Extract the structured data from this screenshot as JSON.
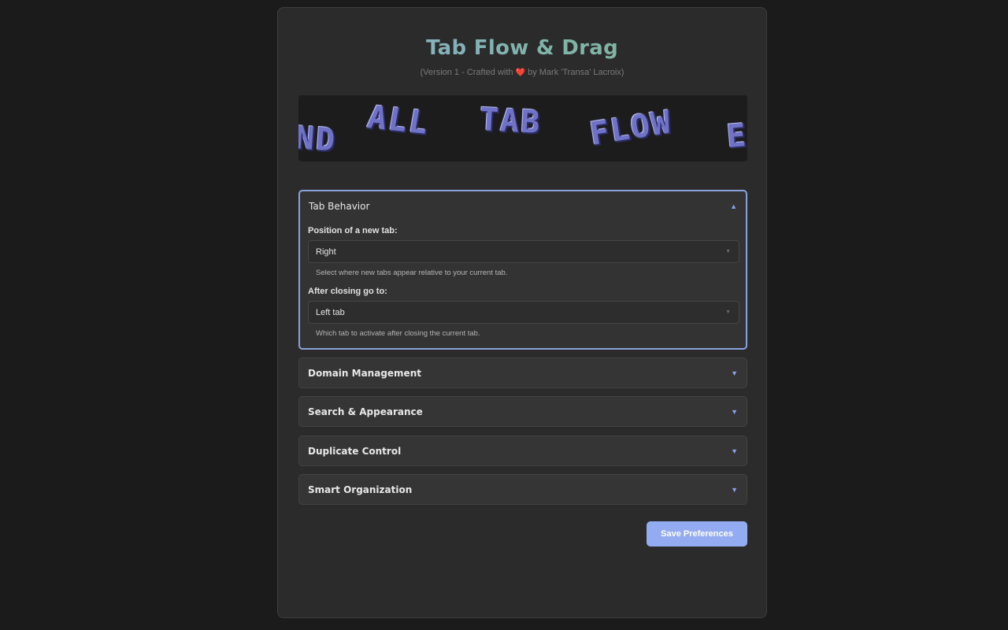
{
  "app": {
    "title": "Tab Flow & Drag",
    "subtitle_prefix": "(Version 1 - Crafted with",
    "subtitle_heart": "❤️",
    "subtitle_suffix": "by Mark 'Transa' Lacroix)"
  },
  "banner": {
    "words": [
      "ND",
      "ALL",
      "TAB",
      "FLOW",
      "E"
    ]
  },
  "sections": {
    "tab_behavior": {
      "title": "Tab Behavior",
      "expanded": true,
      "new_tab_position": {
        "label": "Position of a new tab:",
        "value": "Right",
        "help": "Select where new tabs appear relative to your current tab."
      },
      "after_closing": {
        "label": "After closing go to:",
        "value": "Left tab",
        "help": "Which tab to activate after closing the current tab."
      }
    },
    "domain_management": {
      "title": "Domain Management",
      "expanded": false
    },
    "search_appearance": {
      "title": "Search & Appearance",
      "expanded": false
    },
    "duplicate_control": {
      "title": "Duplicate Control",
      "expanded": false
    },
    "smart_organization": {
      "title": "Smart Organization",
      "expanded": false
    }
  },
  "icons": {
    "expanded": "chevron-up-icon",
    "collapsed": "chevron-down-icon",
    "select_caret": "caret-down-icon"
  },
  "colors": {
    "accent": "#8aa2dc",
    "button": "#93acf1",
    "title_gradient_start": "#8fb0d6",
    "title_gradient_end": "#86b89a"
  },
  "actions": {
    "save_label": "Save Preferences"
  }
}
